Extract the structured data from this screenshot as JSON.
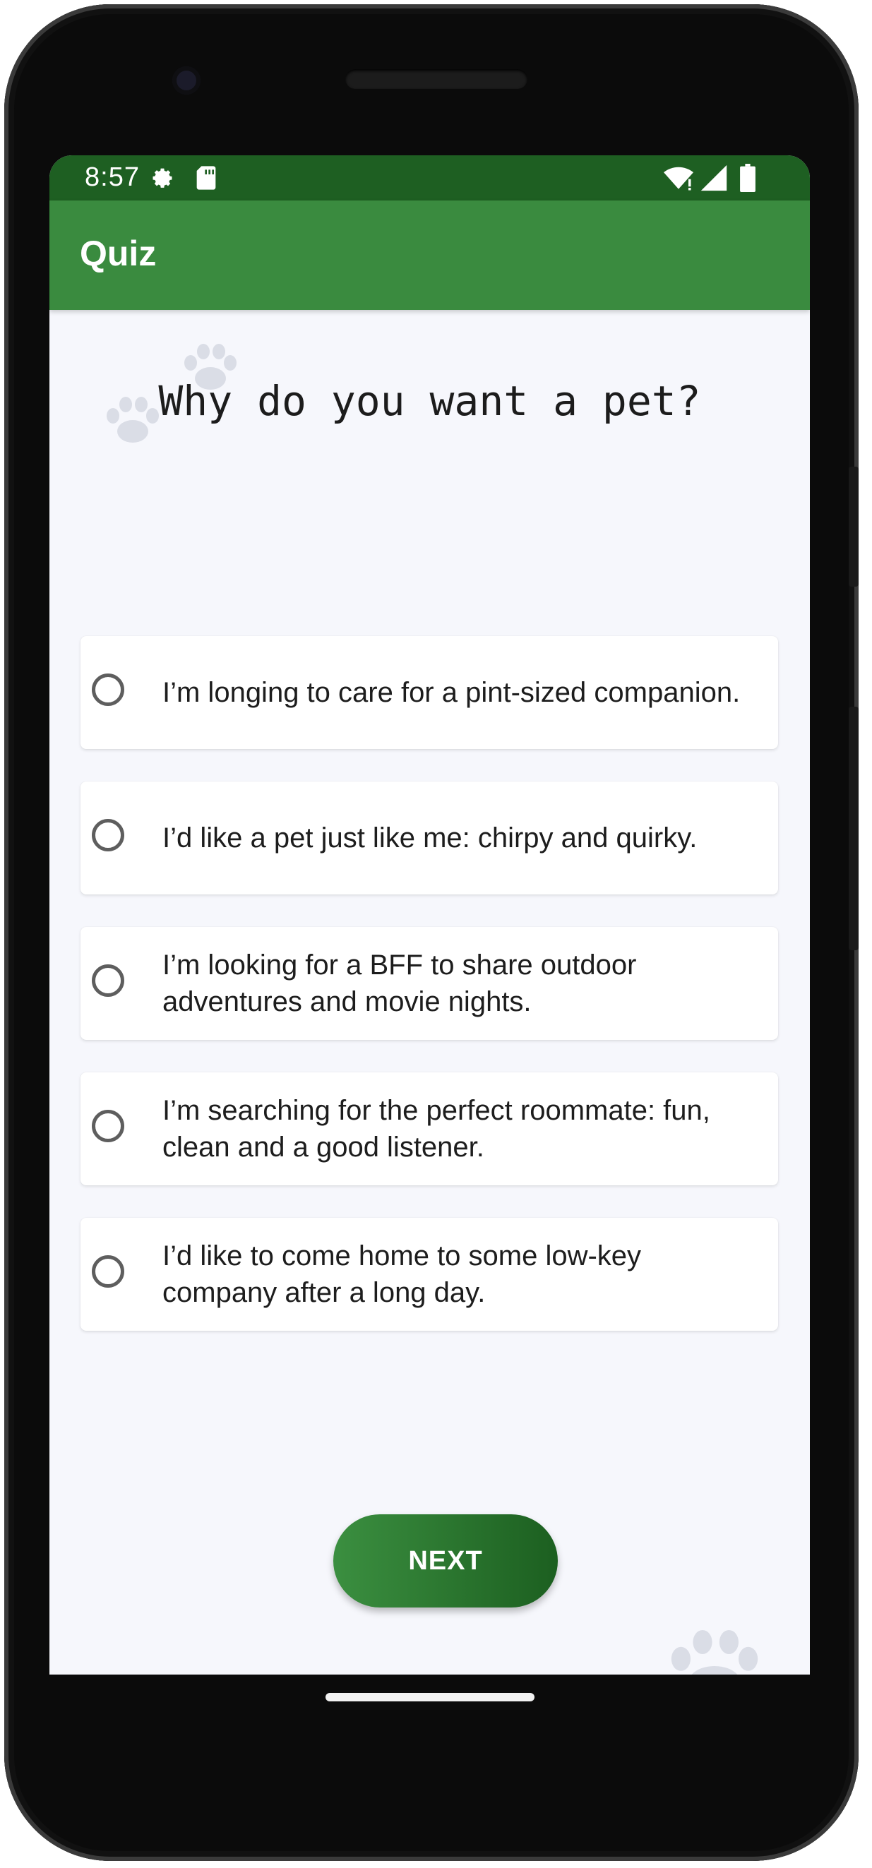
{
  "status_bar": {
    "time": "8:57",
    "left_icons": [
      "settings-gear-icon",
      "sd-card-icon"
    ],
    "right_icons": [
      "wifi-icon",
      "signal-icon",
      "battery-icon"
    ]
  },
  "app_bar": {
    "title": "Quiz"
  },
  "quiz": {
    "question": "Why do you want a pet?",
    "options": [
      {
        "label": "I’m longing to care for a pint-sized companion.",
        "selected": false
      },
      {
        "label": "I’d like a pet just like me: chirpy and quirky.",
        "selected": false
      },
      {
        "label": "I’m looking for a BFF to share outdoor adventures and movie nights.",
        "selected": false
      },
      {
        "label": "I’m searching for the perfect roommate: fun, clean and a good listener.",
        "selected": false
      },
      {
        "label": "I’d like to come home to some low-key company after a long day.",
        "selected": false
      }
    ],
    "next_label": "NEXT"
  },
  "colors": {
    "status_bar": "#1e5f22",
    "app_bar": "#3a8b3f",
    "background": "#f6f7fc",
    "button_start": "#3b8f40",
    "button_end": "#1c5f20"
  }
}
